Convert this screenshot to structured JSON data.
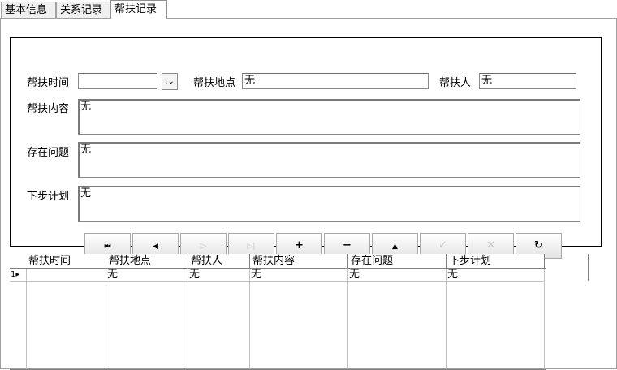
{
  "tabs": [
    {
      "label": "基本信息",
      "active": false
    },
    {
      "label": "关系记录",
      "active": false
    },
    {
      "label": "帮扶记录",
      "active": true
    }
  ],
  "form": {
    "time_label": "帮扶时间",
    "time_value": "",
    "place_label": "帮扶地点",
    "place_value": "无",
    "helper_label": "帮扶人",
    "helper_value": "无",
    "content_label": "帮扶内容",
    "content_value": "无",
    "problem_label": "存在问题",
    "problem_value": "无",
    "plan_label": "下步计划",
    "plan_value": "无"
  },
  "navigator": [
    {
      "icon": "first-record-icon",
      "glyph": "⏮",
      "enabled": true
    },
    {
      "icon": "prior-record-icon",
      "glyph": "◀",
      "enabled": true
    },
    {
      "icon": "next-record-icon",
      "glyph": "▷",
      "enabled": false
    },
    {
      "icon": "last-record-icon",
      "glyph": "▷|",
      "enabled": false
    },
    {
      "icon": "insert-record-icon",
      "glyph": "+",
      "enabled": true
    },
    {
      "icon": "delete-record-icon",
      "glyph": "−",
      "enabled": true
    },
    {
      "icon": "edit-record-icon",
      "glyph": "▲",
      "enabled": true
    },
    {
      "icon": "post-record-icon",
      "glyph": "✓",
      "enabled": false
    },
    {
      "icon": "cancel-record-icon",
      "glyph": "✕",
      "enabled": false
    },
    {
      "icon": "refresh-record-icon",
      "glyph": "↻",
      "enabled": true
    }
  ],
  "grid": {
    "columns": [
      "帮扶时间",
      "帮扶地点",
      "帮扶人",
      "帮扶内容",
      "存在问题",
      "下步计划"
    ],
    "rows": [
      [
        "",
        "无",
        "无",
        "无",
        "无",
        "无"
      ]
    ],
    "row_indicator": "1▸"
  }
}
